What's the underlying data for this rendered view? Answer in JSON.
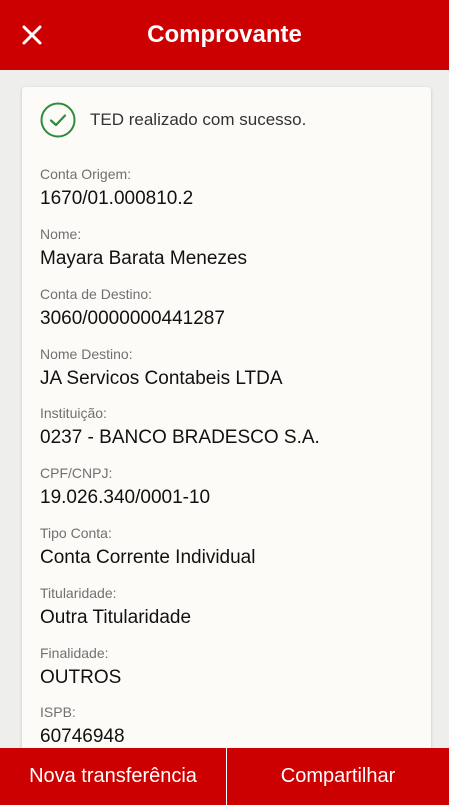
{
  "header": {
    "title": "Comprovante",
    "close_icon": "close-icon",
    "background": "#cc0000"
  },
  "status": {
    "icon": "check-circle-icon",
    "icon_color": "#2e8b3a",
    "message": "TED realizado com sucesso."
  },
  "fields": [
    {
      "label": "Conta Origem:",
      "value": "1670/01.000810.2"
    },
    {
      "label": "Nome:",
      "value": "Mayara Barata Menezes"
    },
    {
      "label": "Conta de Destino:",
      "value": "3060/0000000441287"
    },
    {
      "label": "Nome Destino:",
      "value": "JA Servicos Contabeis LTDA"
    },
    {
      "label": "Instituição:",
      "value": "0237 - BANCO BRADESCO S.A."
    },
    {
      "label": "CPF/CNPJ:",
      "value": "19.026.340/0001-10"
    },
    {
      "label": "Tipo Conta:",
      "value": "Conta Corrente Individual"
    },
    {
      "label": "Titularidade:",
      "value": "Outra Titularidade"
    },
    {
      "label": "Finalidade:",
      "value": "OUTROS"
    },
    {
      "label": "ISPB:",
      "value": "60746948"
    }
  ],
  "footer": {
    "new_transfer_label": "Nova transferência",
    "share_label": "Compartilhar"
  }
}
